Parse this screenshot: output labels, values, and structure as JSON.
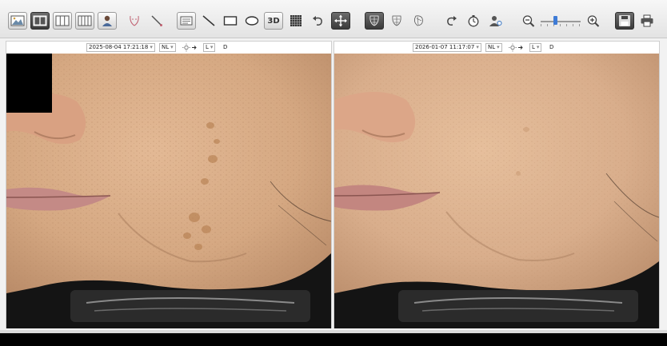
{
  "toolbar": {
    "buttons": [
      {
        "name": "single-image-view",
        "icon": "image-icon"
      },
      {
        "name": "two-image-view",
        "icon": "two-columns-icon",
        "active": true
      },
      {
        "name": "three-image-view",
        "icon": "three-columns-icon"
      },
      {
        "name": "four-image-view",
        "icon": "four-columns-icon"
      },
      {
        "name": "patient-view",
        "icon": "person-icon"
      },
      {
        "name": "face-map",
        "icon": "face-outline-icon"
      },
      {
        "name": "eyedropper",
        "icon": "eyedropper-icon"
      },
      {
        "name": "text-annotation",
        "icon": "text-box-icon"
      },
      {
        "name": "line-tool",
        "icon": "line-icon"
      },
      {
        "name": "rectangle-tool",
        "icon": "rectangle-icon"
      },
      {
        "name": "ellipse-tool",
        "icon": "ellipse-icon"
      },
      {
        "name": "3d-view",
        "icon": "3d-icon",
        "label": "3D"
      },
      {
        "name": "grid-overlay",
        "icon": "grid-icon"
      },
      {
        "name": "undo",
        "icon": "undo-icon"
      },
      {
        "name": "move-tool",
        "icon": "move-icon",
        "active": true
      },
      {
        "name": "face-analysis-front",
        "icon": "face-mesh-icon",
        "active": true
      },
      {
        "name": "face-analysis-top",
        "icon": "face-mesh-top-icon"
      },
      {
        "name": "face-analysis-side",
        "icon": "face-mesh-side-icon"
      },
      {
        "name": "redo",
        "icon": "redo-icon"
      },
      {
        "name": "timer",
        "icon": "timer-icon"
      },
      {
        "name": "patient-search",
        "icon": "person-search-icon"
      },
      {
        "name": "zoom-out",
        "icon": "zoom-out-icon"
      },
      {
        "name": "zoom-in",
        "icon": "zoom-in-icon"
      },
      {
        "name": "save",
        "icon": "save-icon",
        "active": true
      },
      {
        "name": "print",
        "icon": "print-icon"
      }
    ],
    "zoom_level": 0.35
  },
  "panes": {
    "left": {
      "date": "2025-08-04 17:21:18",
      "mode": "NL",
      "side": "L",
      "extra": "D"
    },
    "right": {
      "date": "2026-01-07 11:17:07",
      "mode": "NL",
      "side": "L",
      "extra": "D"
    }
  },
  "colors": {
    "skin": "#d9ae8c",
    "background": "#1a1a1a",
    "toolbar": "#e8e8e8"
  }
}
